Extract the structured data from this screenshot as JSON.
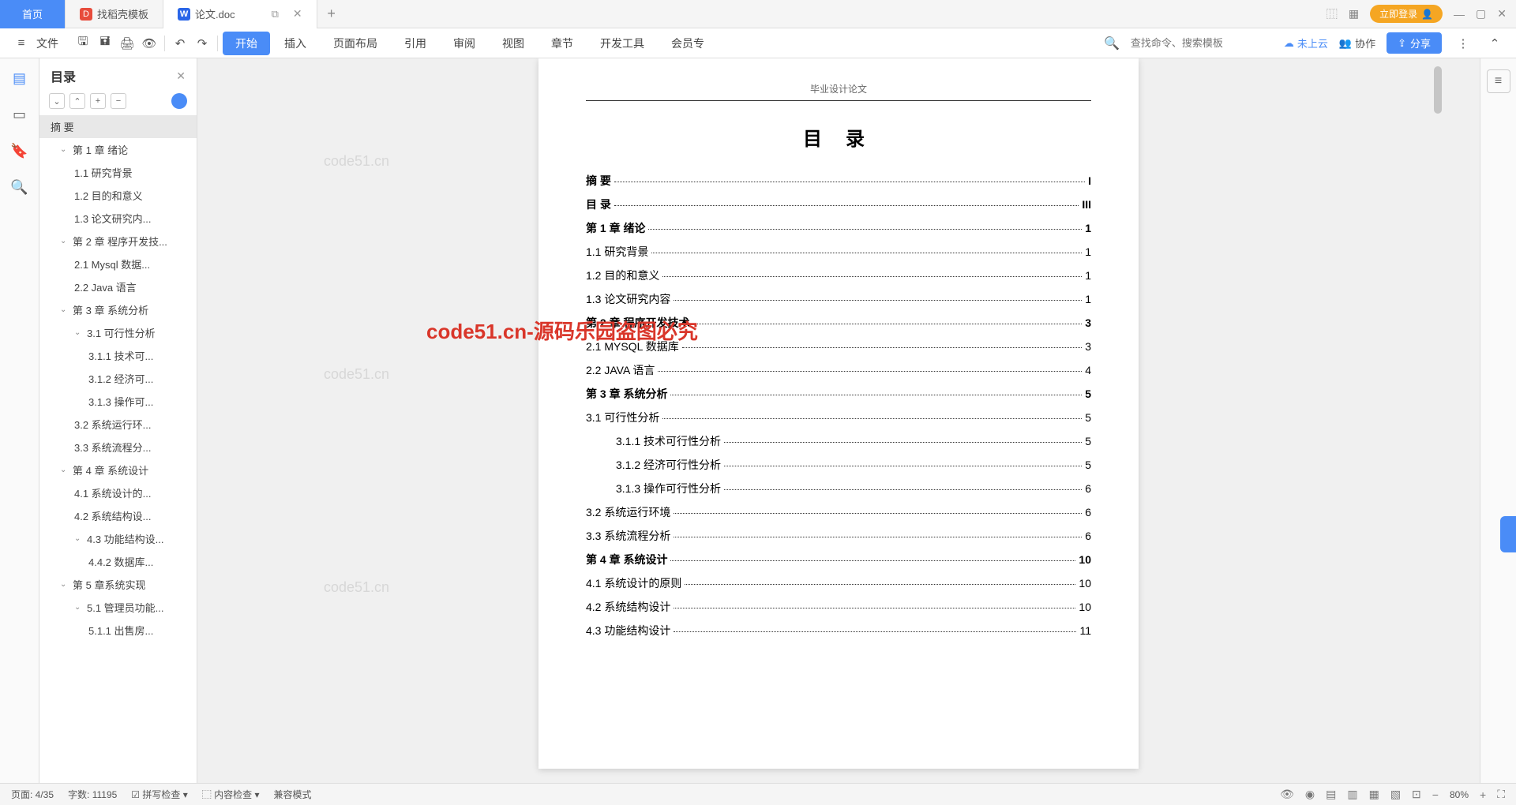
{
  "tabs": {
    "home": "首页",
    "t1": "找稻壳模板",
    "t2": "论文.doc"
  },
  "titlebar": {
    "login": "立即登录"
  },
  "toolbar": {
    "file": "文件"
  },
  "menu": {
    "start": "开始",
    "insert": "插入",
    "layout": "页面布局",
    "ref": "引用",
    "review": "审阅",
    "view": "视图",
    "chapter": "章节",
    "devtools": "开发工具",
    "member": "会员专",
    "search_ph": "查找命令、搜索模板",
    "cloud": "未上云",
    "collab": "协作",
    "share": "分享"
  },
  "outline": {
    "title": "目录",
    "items": [
      {
        "lvl": 0,
        "text": "摘  要",
        "sel": true
      },
      {
        "lvl": 1,
        "text": "第 1 章 绪论",
        "chev": true
      },
      {
        "lvl": 2,
        "text": "1.1 研究背景"
      },
      {
        "lvl": 2,
        "text": "1.2 目的和意义"
      },
      {
        "lvl": 2,
        "text": "1.3 论文研究内..."
      },
      {
        "lvl": 1,
        "text": "第 2 章 程序开发技...",
        "chev": true
      },
      {
        "lvl": 2,
        "text": "2.1 Mysql 数据..."
      },
      {
        "lvl": 2,
        "text": "2.2 Java 语言"
      },
      {
        "lvl": 1,
        "text": "第 3 章 系统分析",
        "chev": true
      },
      {
        "lvl": 2,
        "text": "3.1 可行性分析",
        "chev": true
      },
      {
        "lvl": 3,
        "text": "3.1.1 技术可..."
      },
      {
        "lvl": 3,
        "text": "3.1.2 经济可..."
      },
      {
        "lvl": 3,
        "text": "3.1.3 操作可..."
      },
      {
        "lvl": 2,
        "text": "3.2 系统运行环..."
      },
      {
        "lvl": 2,
        "text": "3.3 系统流程分..."
      },
      {
        "lvl": 1,
        "text": "第 4 章 系统设计",
        "chev": true
      },
      {
        "lvl": 2,
        "text": "4.1 系统设计的..."
      },
      {
        "lvl": 2,
        "text": "4.2 系统结构设..."
      },
      {
        "lvl": 2,
        "text": "4.3 功能结构设...",
        "chev": true
      },
      {
        "lvl": 3,
        "text": "4.4.2 数据库..."
      },
      {
        "lvl": 1,
        "text": "第 5 章系统实现",
        "chev": true
      },
      {
        "lvl": 2,
        "text": "5.1 管理员功能...",
        "chev": true
      },
      {
        "lvl": 3,
        "text": "5.1.1 出售房..."
      }
    ]
  },
  "doc": {
    "header": "毕业设计论文",
    "title": "目  录",
    "toc": [
      {
        "lvl": 0,
        "text": "摘  要",
        "page": "I"
      },
      {
        "lvl": 0,
        "text": "目  录",
        "page": "III"
      },
      {
        "lvl": 0,
        "text": "第 1 章  绪论",
        "page": "1"
      },
      {
        "lvl": 1,
        "text": "1.1  研究背景",
        "page": "1"
      },
      {
        "lvl": 1,
        "text": "1.2  目的和意义",
        "page": "1"
      },
      {
        "lvl": 1,
        "text": "1.3  论文研究内容",
        "page": "1"
      },
      {
        "lvl": 0,
        "text": "第 2 章  程序开发技术",
        "page": "3"
      },
      {
        "lvl": 1,
        "text": "2.1 MYSQL 数据库",
        "page": "3"
      },
      {
        "lvl": 1,
        "text": "2.2 JAVA 语言",
        "page": "4"
      },
      {
        "lvl": 0,
        "text": "第 3 章  系统分析",
        "page": "5"
      },
      {
        "lvl": 1,
        "text": "3.1 可行性分析",
        "page": "5"
      },
      {
        "lvl": 2,
        "text": "3.1.1 技术可行性分析",
        "page": "5"
      },
      {
        "lvl": 2,
        "text": "3.1.2 经济可行性分析",
        "page": "5"
      },
      {
        "lvl": 2,
        "text": "3.1.3 操作可行性分析",
        "page": "6"
      },
      {
        "lvl": 1,
        "text": "3.2 系统运行环境",
        "page": "6"
      },
      {
        "lvl": 1,
        "text": "3.3 系统流程分析",
        "page": "6"
      },
      {
        "lvl": 0,
        "text": "第 4 章  系统设计",
        "page": "10"
      },
      {
        "lvl": 1,
        "text": "4.1 系统设计的原则",
        "page": "10"
      },
      {
        "lvl": 1,
        "text": "4.2 系统结构设计",
        "page": "10"
      },
      {
        "lvl": 1,
        "text": "4.3 功能结构设计",
        "page": "11"
      }
    ]
  },
  "watermarks": {
    "wm": "code51.cn",
    "red": "code51.cn-源码乐园盗图必究"
  },
  "status": {
    "page": "页面: 4/35",
    "words": "字数: 11195",
    "spell": "拼写检查",
    "content": "内容检查",
    "compat": "兼容模式",
    "zoom": "80%"
  }
}
